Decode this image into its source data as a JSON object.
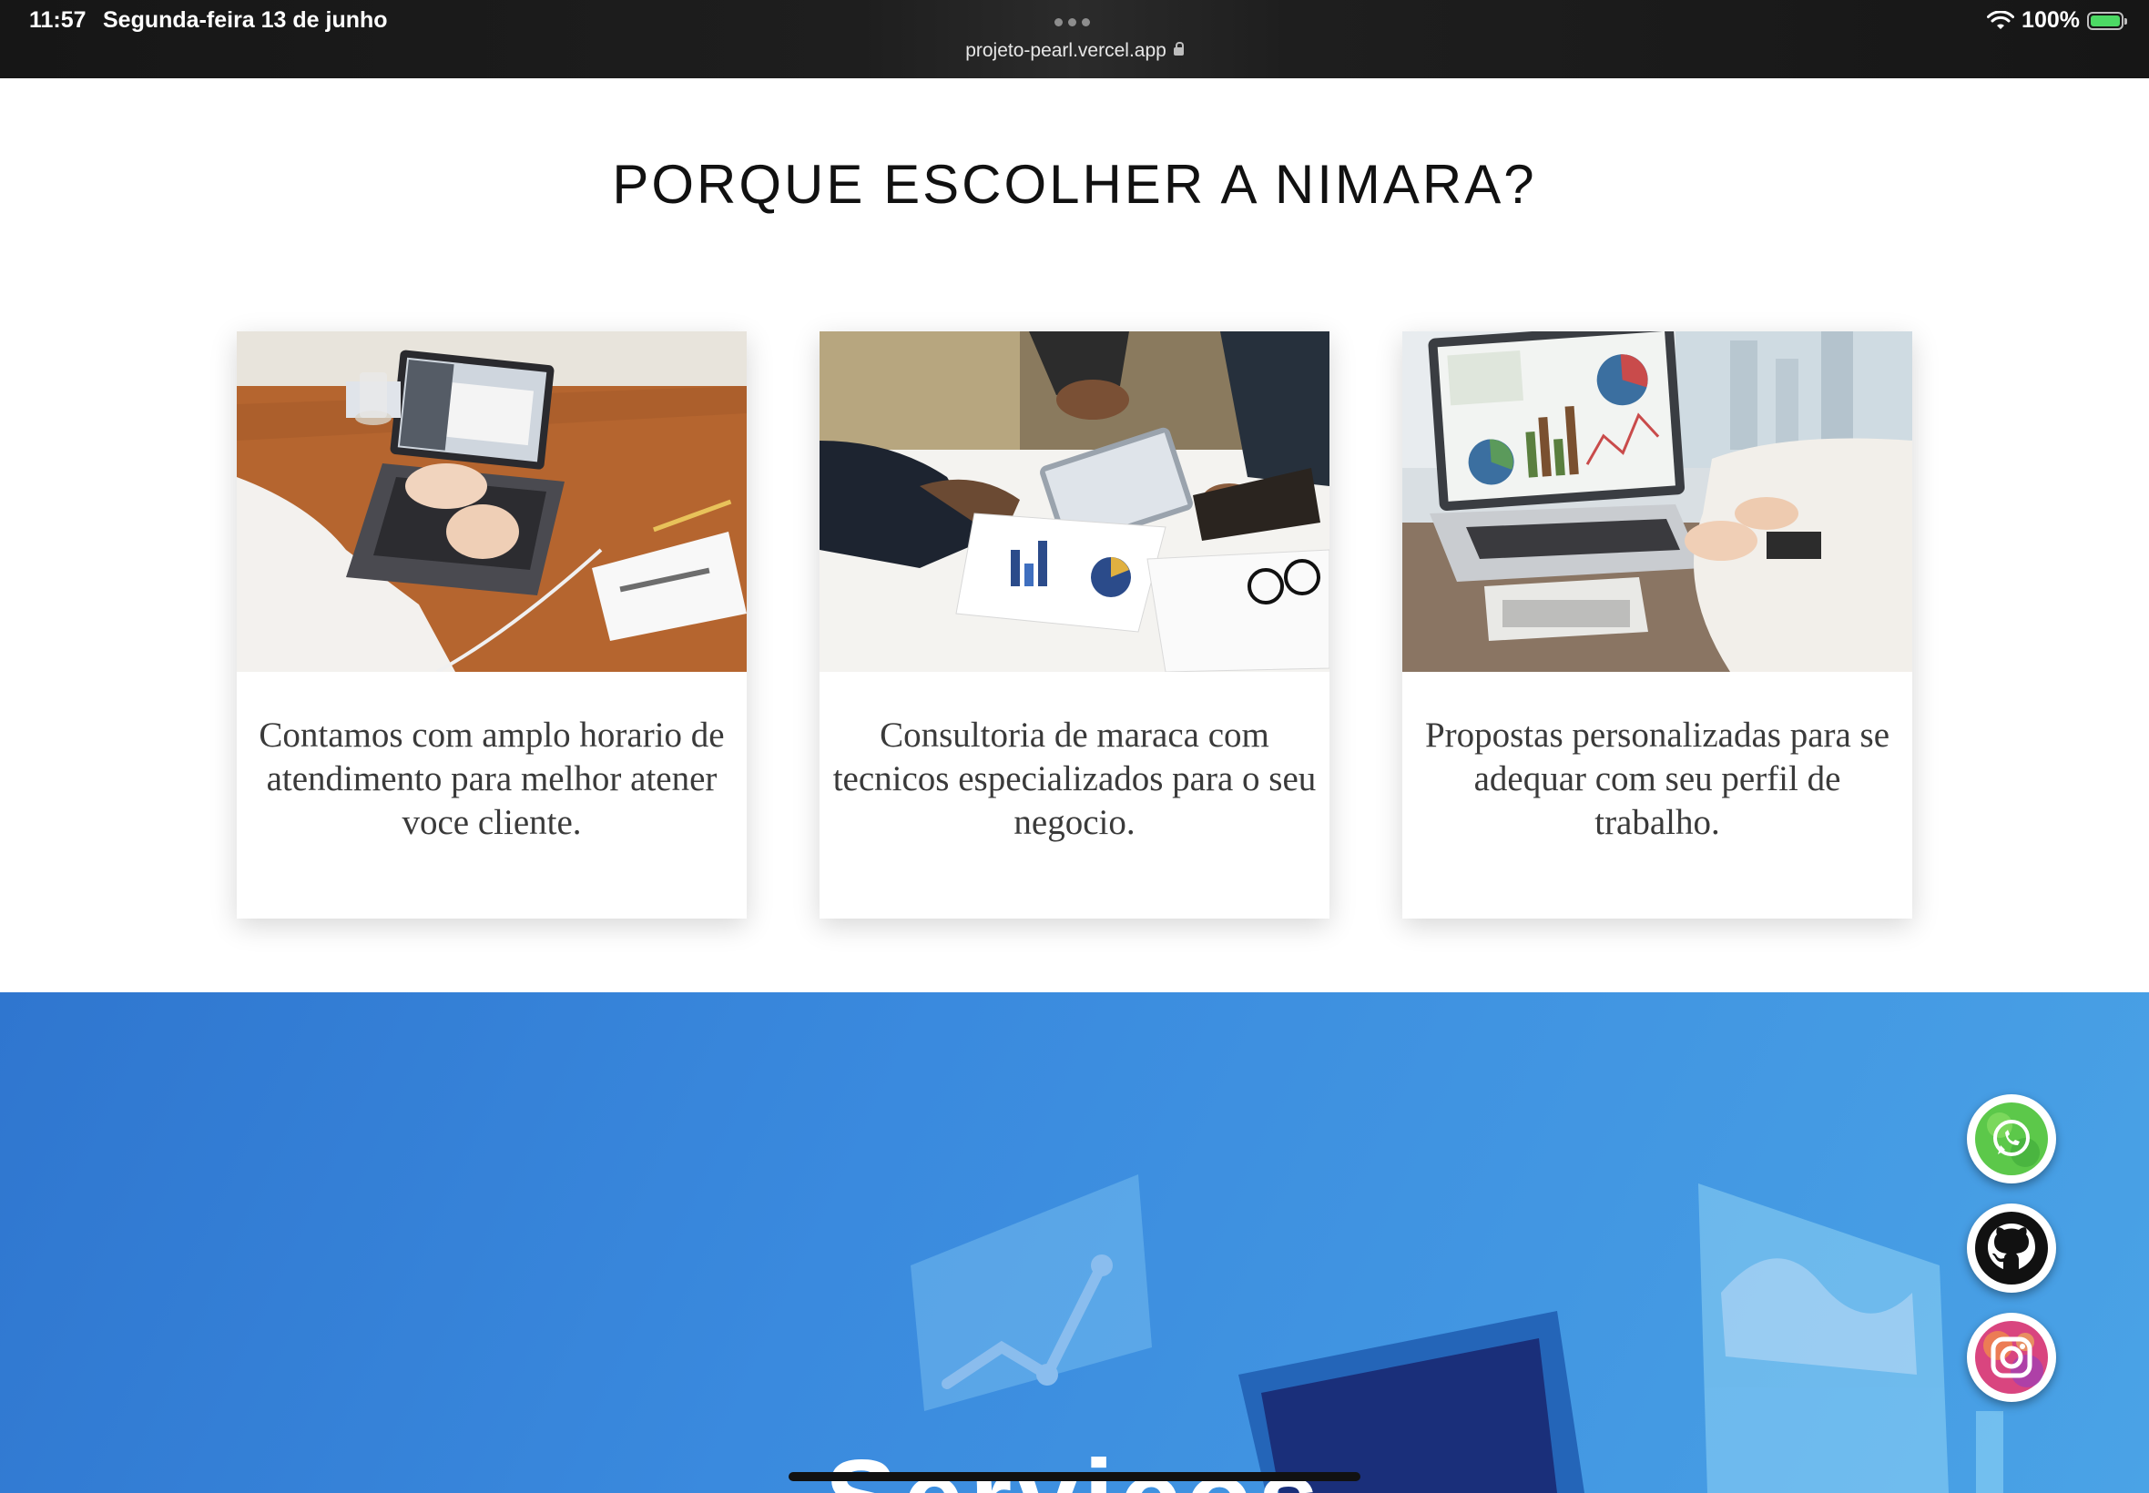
{
  "status_bar": {
    "time": "11:57",
    "date": "Segunda-feira 13 de junho",
    "url": "projeto-pearl.vercel.app",
    "battery": "100%"
  },
  "why": {
    "title": "PORQUE ESCOLHER A NIMARA?",
    "cards": [
      {
        "text": "Contamos com amplo horario de atendimento para melhor atener voce cliente."
      },
      {
        "text": "Consultoria de maraca com tecnicos especializados para o seu negocio."
      },
      {
        "text": "Propostas personalizadas para se adequar com seu perfil de trabalho."
      }
    ]
  },
  "services": {
    "heading": "Servicos"
  },
  "social": {
    "whatsapp_icon": "whatsapp-icon",
    "github_icon": "github-icon",
    "instagram_icon": "instagram-icon"
  },
  "colors": {
    "services_blue": "#3a8ade",
    "whatsapp_green": "#4cd964",
    "github_black": "#111111",
    "instagram_pink": "#e04a7a"
  }
}
